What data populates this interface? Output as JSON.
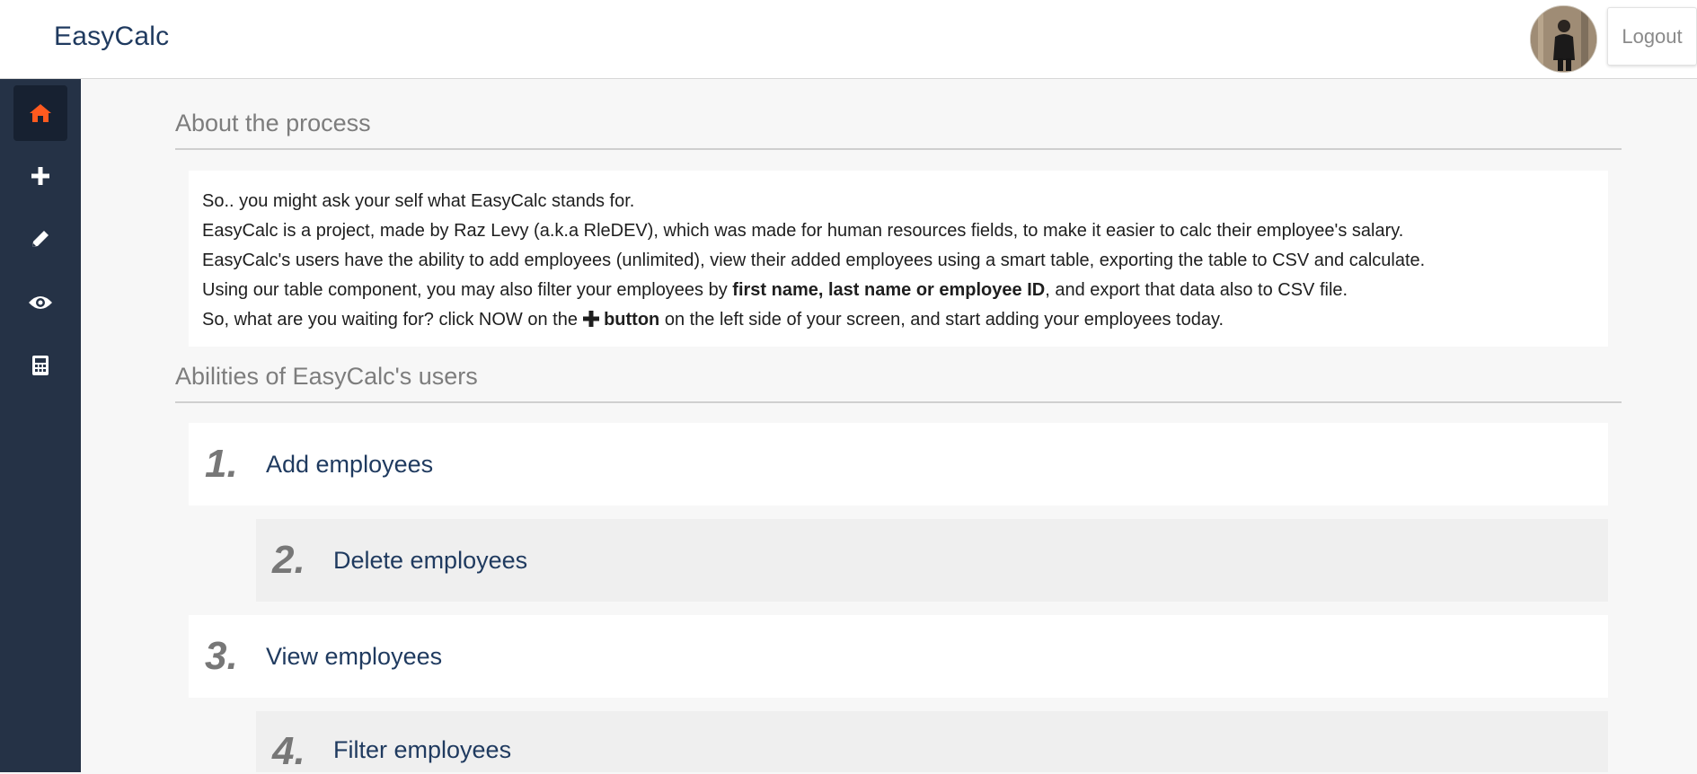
{
  "header": {
    "brand": "EasyCalc",
    "logout_label": "Logout"
  },
  "sidebar": {
    "items": [
      {
        "icon": "home-icon",
        "active": true,
        "color": "#ff5a1f"
      },
      {
        "icon": "plus-icon",
        "active": false,
        "color": "#ffffff"
      },
      {
        "icon": "pencil-icon",
        "active": false,
        "color": "#ffffff"
      },
      {
        "icon": "eye-icon",
        "active": false,
        "color": "#ffffff"
      },
      {
        "icon": "calculator-icon",
        "active": false,
        "color": "#ffffff"
      }
    ]
  },
  "about": {
    "title": "About the process",
    "line1": "So.. you might ask your self what EasyCalc stands for.",
    "line2": "EasyCalc is a project, made by Raz Levy (a.k.a RleDEV), which was made for human resources fields, to make it easier to calc their employee's salary.",
    "line3": "EasyCalc's users have the ability to add employees (unlimited), view their added employees using a smart table, exporting the table to CSV and calculate.",
    "line4_pre": "Using our table component, you may also filter your employees by ",
    "line4_bold": "first name, last name or employee ID",
    "line4_post": ", and export that data also to CSV file.",
    "line5_pre": "So, what are you waiting for? click NOW on the ",
    "line5_bold": "button",
    "line5_post": " on the left side of your screen, and start adding your employees today."
  },
  "abilities": {
    "title": "Abilities of EasyCalc's users",
    "items": [
      {
        "number": "1.",
        "label": "Add employees"
      },
      {
        "number": "2.",
        "label": "Delete employees"
      },
      {
        "number": "3.",
        "label": "View employees"
      },
      {
        "number": "4.",
        "label": "Filter employees"
      }
    ]
  },
  "colors": {
    "brand": "#1f3a5f",
    "sidebar_bg": "#253246",
    "active_icon": "#ff5a1f"
  }
}
